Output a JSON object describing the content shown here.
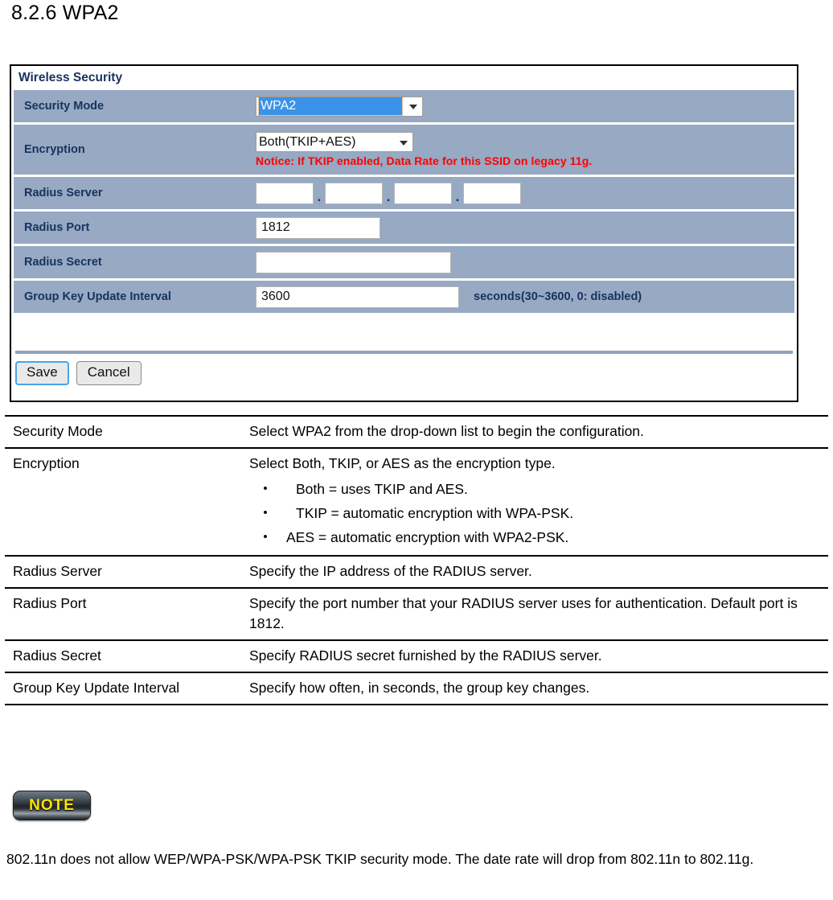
{
  "section": {
    "title": "8.2.6 WPA2"
  },
  "panel": {
    "header": "Wireless Security",
    "rows": {
      "security_mode": {
        "label": "Security Mode",
        "value": "WPA2"
      },
      "encryption": {
        "label": "Encryption",
        "value": "Both(TKIP+AES)",
        "notice": "Notice: If TKIP enabled, Data Rate for this SSID on legacy 11g."
      },
      "radius_server": {
        "label": "Radius Server",
        "octets": [
          "",
          "",
          "",
          ""
        ],
        "separator": "."
      },
      "radius_port": {
        "label": "Radius Port",
        "value": "1812"
      },
      "radius_secret": {
        "label": "Radius Secret",
        "value": ""
      },
      "group_key_update_interval": {
        "label": "Group Key Update Interval",
        "value": "3600",
        "unit": "seconds(30~3600, 0: disabled)"
      }
    },
    "buttons": {
      "save": "Save",
      "cancel": "Cancel"
    }
  },
  "description_table": {
    "rows": [
      {
        "key": "Security Mode",
        "value": "Select WPA2 from the drop-down  list to begin the configuration.",
        "bullets": []
      },
      {
        "key": "Encryption",
        "value": "Select Both, TKIP, or AES as the encryption type.",
        "bullets": [
          "Both = uses TKIP and AES.",
          "TKIP = automatic encryption with WPA-PSK.",
          "AES = automatic encryption with WPA2-PSK."
        ]
      },
      {
        "key": "Radius Server",
        "value": "Specify the IP address of the RADIUS server.",
        "bullets": []
      },
      {
        "key": "Radius Port",
        "value": "Specify the port number that your RADIUS server uses for authentication. Default port is 1812.",
        "bullets": []
      },
      {
        "key": "Radius Secret",
        "value": "Specify RADIUS secret furnished by the RADIUS server.",
        "bullets": []
      },
      {
        "key": "Group Key Update Interval",
        "value": "Specify how often, in seconds, the group key changes.",
        "bullets": []
      }
    ]
  },
  "note": {
    "badge": "NOTE",
    "text": "802.11n does not allow WEP/WPA-PSK/WPA-PSK TKIP security mode. The date rate will drop from 802.11n to 802.11g."
  },
  "colors": {
    "row_bg": "#97a9c3",
    "label_text": "#16335e",
    "notice_red": "#ff0000",
    "select_highlight": "#3a93e8",
    "note_yellow": "#ffe400"
  }
}
